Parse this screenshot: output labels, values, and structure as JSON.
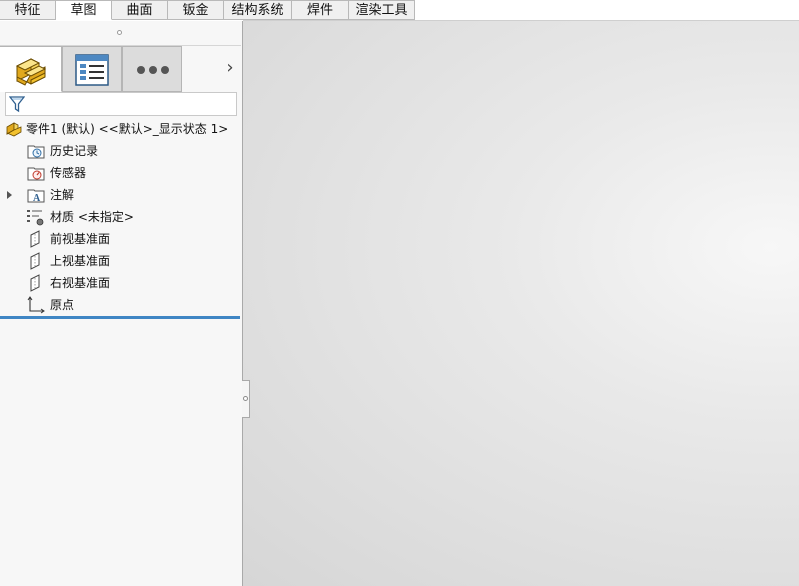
{
  "command_tabs": [
    {
      "label": "特征",
      "active": false
    },
    {
      "label": "草图",
      "active": true
    },
    {
      "label": "曲面",
      "active": false
    },
    {
      "label": "钣金",
      "active": false
    },
    {
      "label": "结构系统",
      "active": false
    },
    {
      "label": "焊件",
      "active": false
    },
    {
      "label": "渲染工具",
      "active": false
    }
  ],
  "manager_tabs": [
    {
      "name": "featuremanager-tab",
      "icon": "part-icon",
      "active": true
    },
    {
      "name": "propertymanager-tab",
      "icon": "property-list-icon",
      "active": false
    },
    {
      "name": "more-tab",
      "icon": "more-icon",
      "active": false
    }
  ],
  "manager_tabs_scroll_icon": "chevron-right-icon",
  "filter": {
    "icon": "filter-icon",
    "value": ""
  },
  "tree": {
    "root": {
      "label": "零件1 (默认) <<默认>_显示状态 1>",
      "icon": "part-icon"
    },
    "items": [
      {
        "label": "历史记录",
        "icon": "history-folder-icon",
        "expandable": false
      },
      {
        "label": "传感器",
        "icon": "sensor-folder-icon",
        "expandable": false
      },
      {
        "label": "注解",
        "icon": "annotation-folder-icon",
        "expandable": true
      },
      {
        "label": "材质 <未指定>",
        "icon": "material-icon",
        "expandable": false
      },
      {
        "label": "前视基准面",
        "icon": "plane-icon",
        "expandable": false
      },
      {
        "label": "上视基准面",
        "icon": "plane-icon",
        "expandable": false
      },
      {
        "label": "右视基准面",
        "icon": "plane-icon",
        "expandable": false
      },
      {
        "label": "原点",
        "icon": "origin-icon",
        "expandable": false
      }
    ]
  },
  "colors": {
    "rollback_bar": "#3f86c4",
    "part_yellow": "#f2c12e",
    "active_tab": "#ffffff"
  }
}
